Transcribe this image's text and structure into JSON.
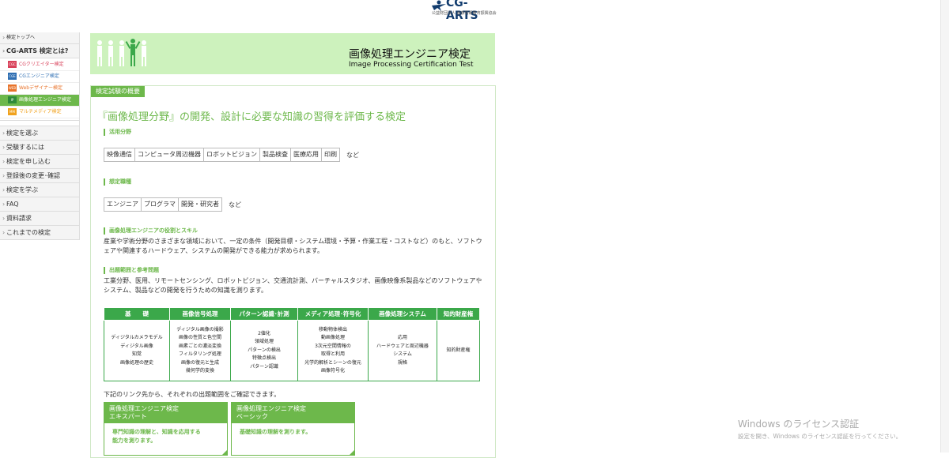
{
  "logo": {
    "name": "CG-ARTS",
    "sub": "公益財団法人 画像情報教育振興協会"
  },
  "sidebar": {
    "top": "検定トップへ",
    "about": "CG-ARTS 検定とは?",
    "exams": [
      {
        "badge": "CGC",
        "label": "CGクリエイター検定",
        "color": "#d9415a"
      },
      {
        "badge": "CGE",
        "label": "CGエンジニア検定",
        "color": "#2f6fb3"
      },
      {
        "badge": "WEB",
        "label": "Webデザイナー検定",
        "color": "#e8732a"
      },
      {
        "badge": "IP",
        "label": "画像処理エンジニア検定",
        "color": "#3ba84a"
      },
      {
        "badge": "MM",
        "label": "マルチメディア検定",
        "color": "#f0a21e"
      }
    ],
    "items": [
      "検定を選ぶ",
      "受験するには",
      "検定を申し込む",
      "登録後の変更･確認",
      "検定を学ぶ",
      "FAQ",
      "資料請求",
      "これまでの検定"
    ]
  },
  "banner": {
    "title_ja": "画像処理エンジニア検定",
    "title_en": "Image Processing Certification Test"
  },
  "section_tab": "検定試験の概要",
  "lead": "『画像処理分野』の開発、設計に必要な知識の習得を評価する検定",
  "fields": {
    "heading": "活用分野",
    "tags": [
      "映像通信",
      "コンピュータ周辺機器",
      "ロボットビジョン",
      "製品検査",
      "医療応用",
      "印刷"
    ],
    "etc": "など"
  },
  "jobs": {
    "heading": "想定職種",
    "tags": [
      "エンジニア",
      "プログラマ",
      "開発・研究者"
    ],
    "etc": "など"
  },
  "skills": {
    "heading": "画像処理エンジニアの役割とスキル",
    "text": "産業や学術分野のさまざまな領域において、一定の条件（開発目標・システム環境・予算・作業工程・コストなど）のもと、ソフトウェアや関連するハードウェア、システムの開発ができる能力が求められます。"
  },
  "scope": {
    "heading": "出題範囲と参考問題",
    "text": "工業分野、医用、リモートセンシング、ロボットビジョン、交通流計測、バーチャルスタジオ、画像映像系製品などのソフトウェアやシステム、製品などの開発を行うための知識を測ります。"
  },
  "table": {
    "headers": [
      "基　　礎",
      "画像信号処理",
      "パターン認識･計測",
      "メディア処理･符号化",
      "画像処理システム",
      "知的財産権"
    ],
    "cells": [
      [
        "ディジタルカメラモデル",
        "ディジタル画像",
        "知覚",
        "画像処理の歴史"
      ],
      [
        "ディジタル画像の撮影",
        "画像の性質と色空間",
        "画素ごとの濃淡変換",
        "フィルタリング処理",
        "画像の復元と生成",
        "幾何学的変換"
      ],
      [
        "2値化",
        "領域処理",
        "パターンの検出",
        "特徴点検出",
        "パターン認識"
      ],
      [
        "移動物体検出",
        "動画像処理",
        "3次元空間情報の",
        "取得と利用",
        "光学的解析とシーンの復元",
        "画像符号化"
      ],
      [
        "応用",
        "ハードウェアと周辺機器",
        "システム",
        "規格"
      ],
      [
        "知的財産権"
      ]
    ]
  },
  "link_note": "下記のリンク先から、それぞれの出題範囲をご確認できます。",
  "cards": [
    {
      "title1": "画像処理エンジニア検定",
      "title2": "エキスパート",
      "body1": "専門知識の理解と、知識を応用する",
      "body2": "能力を測ります。"
    },
    {
      "title1": "画像処理エンジニア検定",
      "title2": "ベーシック",
      "body1": "基礎知識の理解を測ります。",
      "body2": ""
    }
  ],
  "watermark": {
    "line1": "Windows のライセンス認証",
    "line2": "設定を開き、Windows のライセンス認証を行ってください。"
  }
}
